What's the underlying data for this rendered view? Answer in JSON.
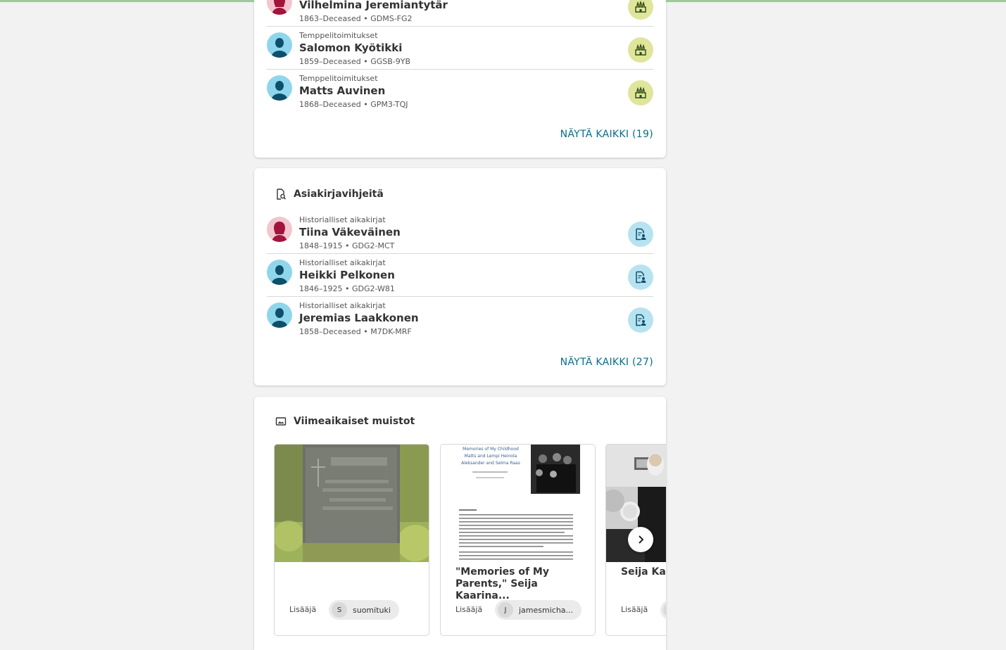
{
  "temple_card": {
    "rows": [
      {
        "kind": "",
        "name": "Vilhelmina Jeremiantytär",
        "meta": "1863–Deceased • GDMS-FG2",
        "gender": "female"
      },
      {
        "kind": "Temppelitoimitukset",
        "name": "Salomon Kyötikki",
        "meta": "1859–Deceased • GGSB-9YB",
        "gender": "male"
      },
      {
        "kind": "Temppelitoimitukset",
        "name": "Matts Auvinen",
        "meta": "1868–Deceased • GPM3-TQJ",
        "gender": "male"
      }
    ],
    "show_all": "NÄYTÄ KAIKKI (19)",
    "action_icon": "temple-icon"
  },
  "records_card": {
    "title": "Asiakirjavihjeitä",
    "title_icon": "record-search-icon",
    "rows": [
      {
        "kind": "Historialliset aikakirjat",
        "name": "Tiina Väkeväinen",
        "meta": "1848–1915 • GDG2-MCT",
        "gender": "female"
      },
      {
        "kind": "Historialliset aikakirjat",
        "name": "Heikki Pelkonen",
        "meta": "1846–1925 • GDG2-W81",
        "gender": "male"
      },
      {
        "kind": "Historialliset aikakirjat",
        "name": "Jeremias Laakkonen",
        "meta": "1858–Deceased • M7DK-MRF",
        "gender": "male"
      }
    ],
    "show_all": "NÄYTÄ KAIKKI (27)",
    "action_icon": "record-hint-icon"
  },
  "memories_card": {
    "title": "Viimeaikaiset muistot",
    "title_icon": "image-icon",
    "items": [
      {
        "title": "",
        "added_label": "Lisääjä",
        "user_initial": "S",
        "user": "suomituki"
      },
      {
        "title": "\"Memories of My Parents,\" Seija Kaarina...",
        "added_label": "Lisääjä",
        "user_initial": "J",
        "user": "jamesmicha...",
        "doc_heading": "Memories of My Childhood",
        "doc_line2": "Matts and Lempi Heinola",
        "doc_line3": "Aleksander and Selma Raas"
      },
      {
        "title": "Seija Kaa with pare",
        "added_label": "Lisääjä",
        "user_initial": "",
        "user": ""
      }
    ],
    "next_icon": "chevron-right-icon"
  },
  "colors": {
    "link": "#0a6c8a",
    "temple_button": "#dfe59b",
    "record_button": "#b7e3f1",
    "female_avatar": "#f3c6cf",
    "male_avatar": "#8fd6ec"
  }
}
